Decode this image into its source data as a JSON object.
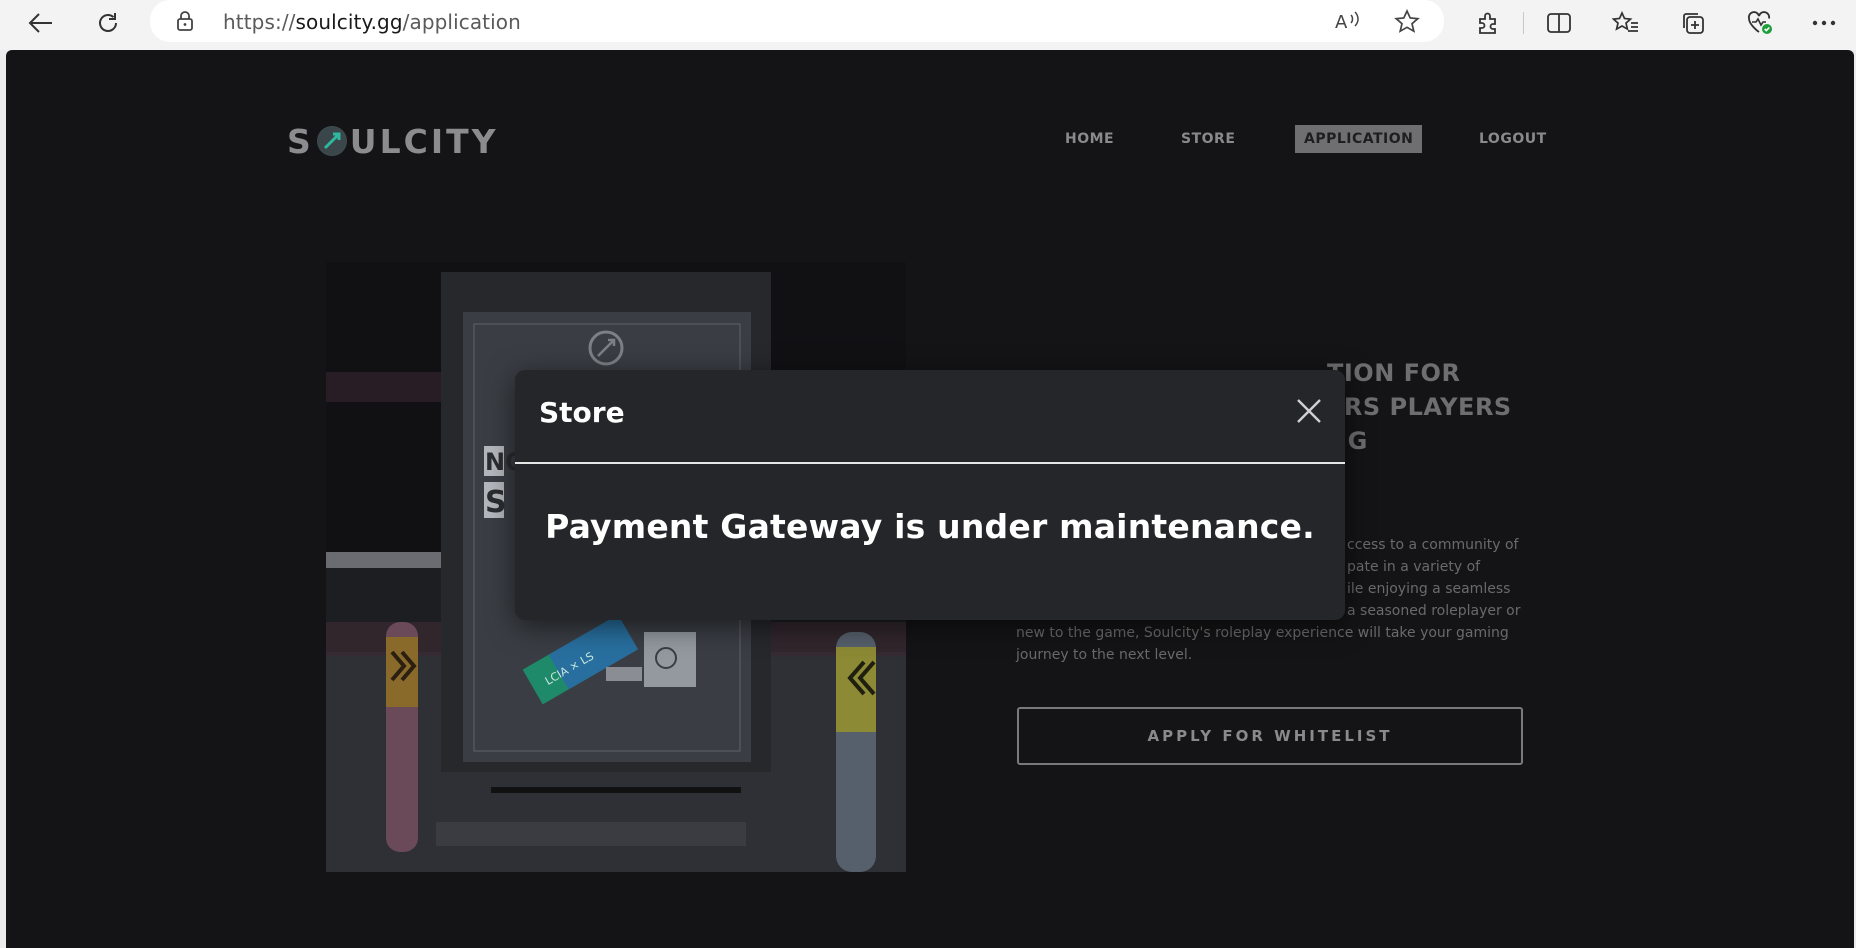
{
  "browser": {
    "url_prefix": "https://",
    "url_domain": "soulcity.gg",
    "url_path": "/application",
    "icons": [
      "back-icon",
      "refresh-icon",
      "lock-icon",
      "read-aloud-icon",
      "favorite-star-icon",
      "extensions-icon",
      "split-screen-icon",
      "favorites-icon",
      "collections-icon",
      "browser-essentials-icon",
      "more-icon"
    ]
  },
  "site": {
    "logo_left": "S",
    "logo_right": "ULCITY",
    "nav": [
      {
        "label": "HOME",
        "active": false
      },
      {
        "label": "STORE",
        "active": false
      },
      {
        "label": "APPLICATION",
        "active": true
      },
      {
        "label": "LOGOUT",
        "active": false
      }
    ]
  },
  "hero": {
    "title_lines": [
      "TION FOR",
      "ERS PLAYERS",
      "NG"
    ],
    "body_lines": [
      "ccess to a community of",
      "pate in a variety of",
      "ile enjoying a seamless",
      "a seasoned roleplayer or",
      "new to the game, Soulcity's roleplay experience will take your gaming",
      "journey to the next level."
    ],
    "cta": "APPLY FOR WHITELIST",
    "poster_text_left": "NO",
    "poster_text_left2": "S",
    "poster_tag": "LCIA × LS"
  },
  "modal": {
    "title": "Store",
    "message": "Payment Gateway is under maintenance."
  },
  "colors": {
    "page_bg": "#141416",
    "modal_bg": "#252629",
    "nav_active_bg": "#6f6f71",
    "emblem_accent": "#2fb8a0"
  }
}
